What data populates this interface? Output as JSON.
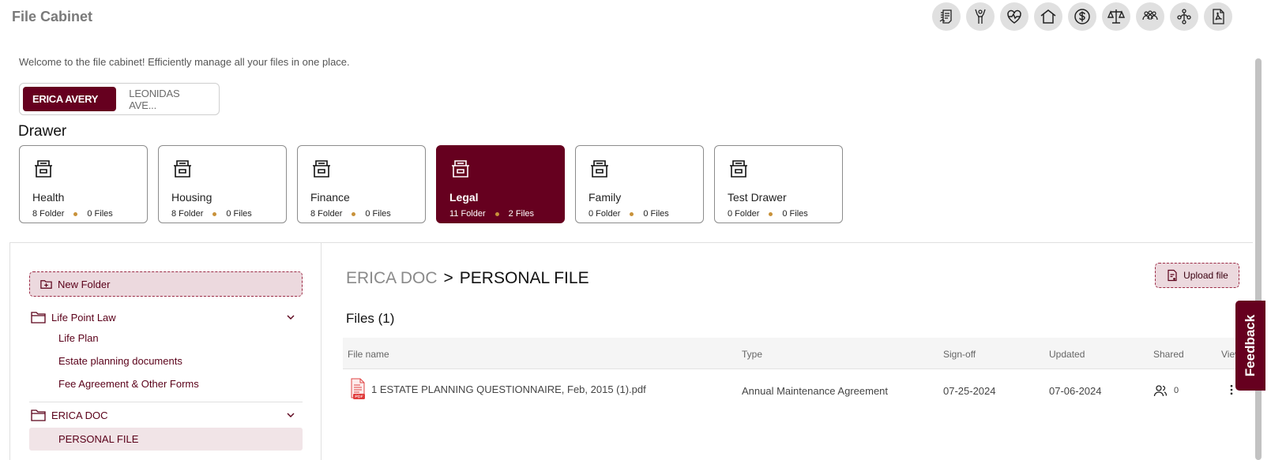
{
  "app": {
    "title": "File Cabinet"
  },
  "top_icons": [
    "documents-icon",
    "hands-raised-icon",
    "heartbeat-icon",
    "home-icon",
    "dollar-icon",
    "scales-icon",
    "family-icon",
    "hierarchy-icon",
    "pdf-icon"
  ],
  "welcome_text": "Welcome to the file cabinet! Efficiently manage all your files in one place.",
  "person_tabs": [
    {
      "label": "ERICA AVERY",
      "active": true
    },
    {
      "label": "LEONIDAS AVE...",
      "active": false
    }
  ],
  "drawer_heading": "Drawer",
  "drawers": [
    {
      "name": "Health",
      "folders": "8 Folder",
      "files": "0 Files",
      "active": false
    },
    {
      "name": "Housing",
      "folders": "8 Folder",
      "files": "0 Files",
      "active": false
    },
    {
      "name": "Finance",
      "folders": "8 Folder",
      "files": "0 Files",
      "active": false
    },
    {
      "name": "Legal",
      "folders": "11 Folder",
      "files": "2 Files",
      "active": true
    },
    {
      "name": "Family",
      "folders": "0 Folder",
      "files": "0 Files",
      "active": false
    },
    {
      "name": "Test Drawer",
      "folders": "0 Folder",
      "files": "0 Files",
      "active": false
    }
  ],
  "sidebar": {
    "new_folder_label": "New Folder",
    "groups": [
      {
        "label": "Life Point Law",
        "items": [
          "Life Plan",
          "Estate planning documents",
          "Fee Agreement & Other Forms"
        ]
      },
      {
        "label": "ERICA DOC",
        "items": [
          "PERSONAL FILE"
        ]
      }
    ]
  },
  "breadcrumb": {
    "parent": "ERICA DOC",
    "separator": ">",
    "current": "PERSONAL FILE"
  },
  "upload_label": "Upload file",
  "files_title": "Files (1)",
  "table": {
    "headers": [
      "File name",
      "Type",
      "Sign-off",
      "Updated",
      "Shared",
      "View"
    ],
    "rows": [
      {
        "file_name": "1 ESTATE PLANNING QUESTIONNAIRE, Feb, 2015 (1).pdf",
        "type": "Annual Maintenance Agreement",
        "sign_off": "07-25-2024",
        "updated": "07-06-2024",
        "shared": "0"
      }
    ]
  },
  "feedback_label": "Feedback",
  "colors": {
    "brand": "#66001f",
    "accent_light": "#ecd9de",
    "dot": "#c8923a"
  }
}
